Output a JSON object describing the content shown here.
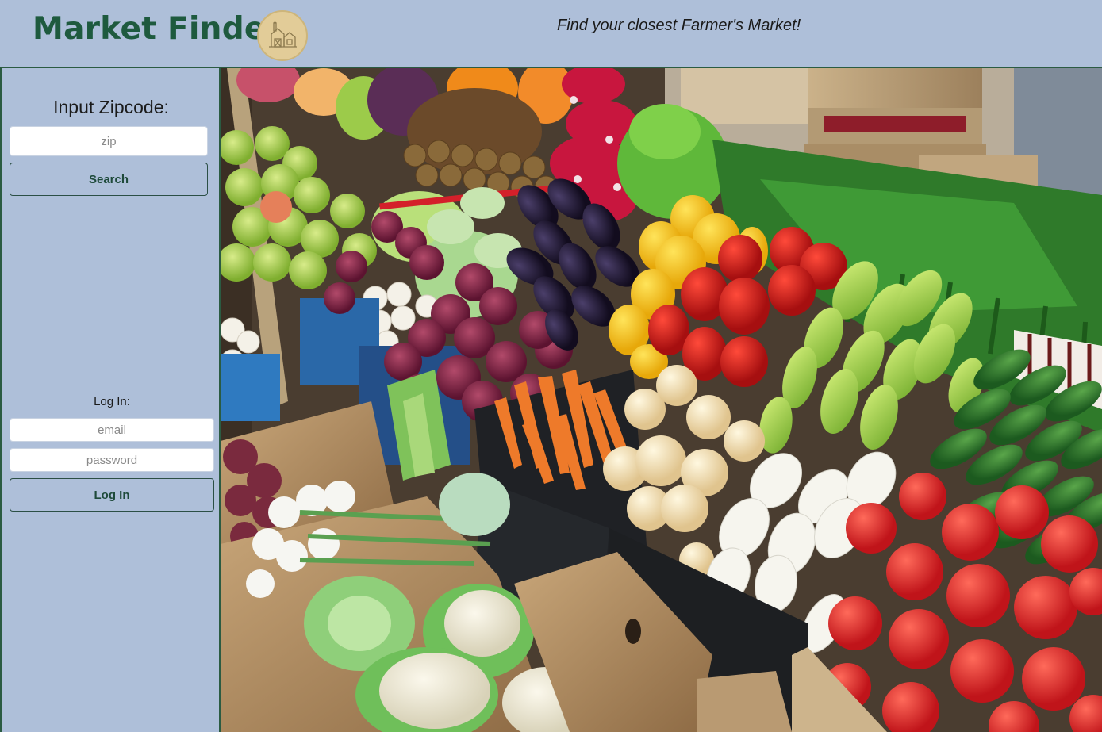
{
  "header": {
    "title": "Market Finder",
    "logo_icon": "barn-logo-icon",
    "tagline": "Find your closest Farmer's Market!"
  },
  "sidebar": {
    "zip_heading": "Input Zipcode:",
    "zip_placeholder": "zip",
    "zip_value": "",
    "search_label": "Search",
    "login_heading": "Log In:",
    "email_placeholder": "email",
    "email_value": "",
    "password_placeholder": "password",
    "password_value": "",
    "login_label": "Log In"
  },
  "hero": {
    "image_subject": "farmers-market-produce-photo"
  },
  "colors": {
    "background": "#aebfd9",
    "brand": "#1e5a3e",
    "border": "#2b5b42",
    "logo_fill": "#e2cc98"
  }
}
